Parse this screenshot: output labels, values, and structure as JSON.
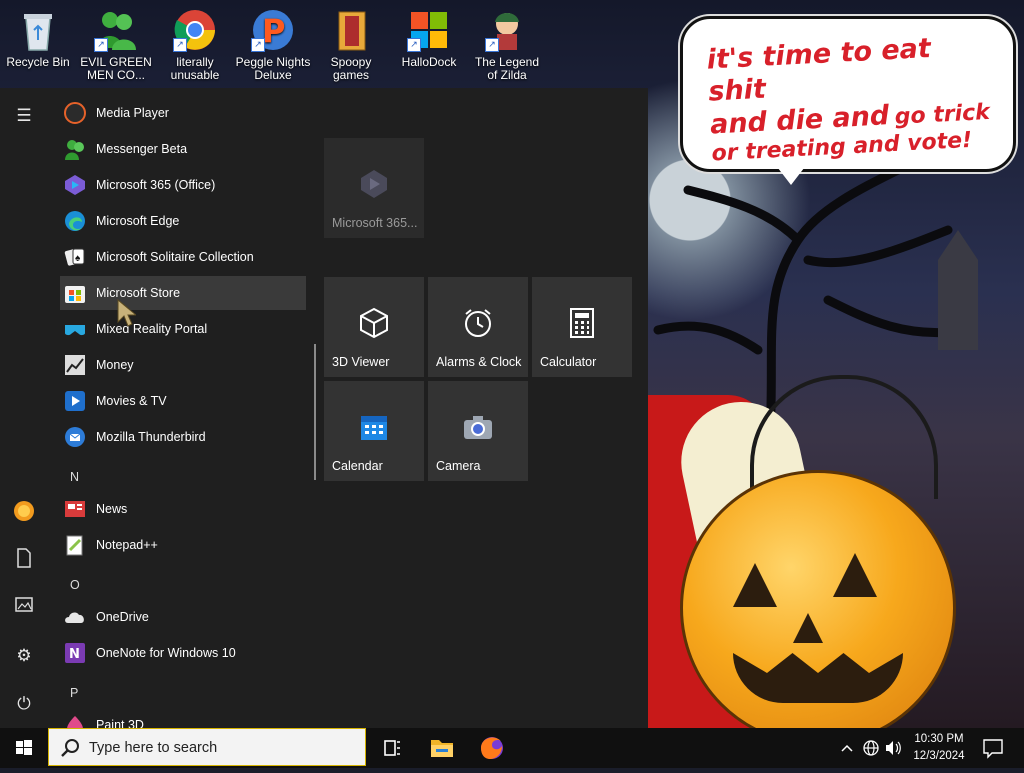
{
  "desktop": {
    "icons": [
      {
        "name": "recycle-bin",
        "label": "Recycle Bin"
      },
      {
        "name": "evil-green-men",
        "label": "EVIL GREEN MEN CO..."
      },
      {
        "name": "chrome",
        "label": "literally unusable"
      },
      {
        "name": "peggle",
        "label": "Peggle Nights Deluxe"
      },
      {
        "name": "spoopy",
        "label": "Spoopy games"
      },
      {
        "name": "hallodock",
        "label": "HalloDock"
      },
      {
        "name": "zilda",
        "label": "The Legend of Zilda"
      }
    ],
    "speech": {
      "line1": "it's time to eat shit",
      "line2a": "and die and",
      "line2b": "go trick",
      "line3": "or treating and vote!"
    }
  },
  "start_menu": {
    "apps": [
      {
        "label": "Media Player",
        "color": "#e6622a"
      },
      {
        "label": "Messenger Beta",
        "color": "#4caf50"
      },
      {
        "label": "Microsoft 365 (Office)",
        "color": "#7b5cd6"
      },
      {
        "label": "Microsoft Edge",
        "color": "#1a8fd6"
      },
      {
        "label": "Microsoft Solitaire Collection",
        "color": "#eeeeee"
      },
      {
        "label": "Microsoft Store",
        "color": "#f2f2f2"
      },
      {
        "label": "Mixed Reality Portal",
        "color": "#28a8e0"
      },
      {
        "label": "Money",
        "color": "#dddddd"
      },
      {
        "label": "Movies & TV",
        "color": "#1f6fcc"
      },
      {
        "label": "Mozilla Thunderbird",
        "color": "#2d7cd8"
      }
    ],
    "letters": {
      "n": "N",
      "o": "O",
      "p": "P"
    },
    "apps_n": [
      {
        "label": "News",
        "color": "#d83b3b"
      },
      {
        "label": "Notepad++",
        "color": "#8bc34a"
      }
    ],
    "apps_o": [
      {
        "label": "OneDrive",
        "color": "#e6e6e6"
      },
      {
        "label": "OneNote for Windows 10",
        "color": "#7b3bb3"
      }
    ],
    "apps_p": [
      {
        "label": "Paint 3D",
        "color": "#e04a8a"
      }
    ],
    "tiles": {
      "m365": "Microsoft 365...",
      "viewer": "3D Viewer",
      "alarms": "Alarms & Clock",
      "calculator": "Calculator",
      "calendar": "Calendar",
      "camera": "Camera"
    }
  },
  "taskbar": {
    "search_placeholder": "Type here to search",
    "time": "10:30 PM",
    "date": "12/3/2024"
  }
}
